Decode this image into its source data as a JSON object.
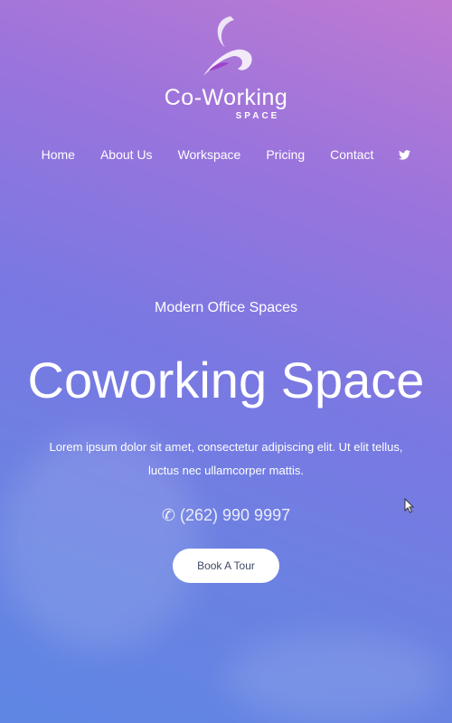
{
  "logo": {
    "brand": "Co-Working",
    "sub": "SPACE"
  },
  "nav": {
    "items": [
      {
        "label": "Home"
      },
      {
        "label": "About Us"
      },
      {
        "label": "Workspace"
      },
      {
        "label": "Pricing"
      },
      {
        "label": "Contact"
      }
    ],
    "social_icon": "twitter-icon"
  },
  "hero": {
    "eyebrow": "Modern Office Spaces",
    "title": "Coworking Space",
    "description": "Lorem ipsum dolor sit amet, consectetur adipiscing elit. Ut elit tellus, luctus nec ullamcorper mattis.",
    "phone": "(262) 990 9997",
    "cta": "Book A Tour"
  },
  "colors": {
    "gradient_top": "#bf7ad2",
    "gradient_bottom": "#5f86e4",
    "button_text": "#3f4a66"
  }
}
